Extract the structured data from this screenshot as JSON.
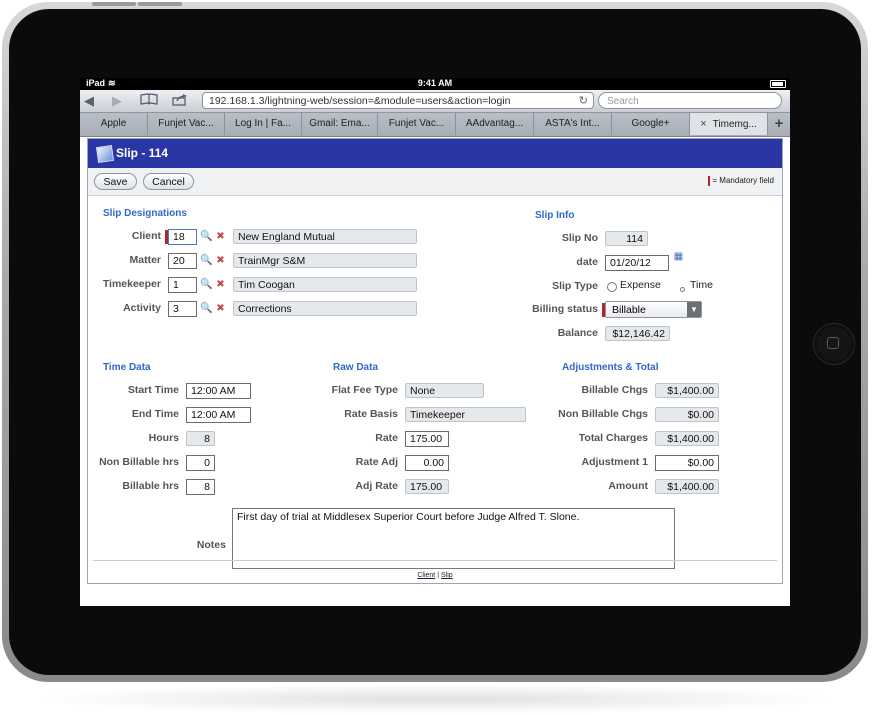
{
  "status_bar": {
    "device": "iPad",
    "time": "9:41 AM"
  },
  "browser": {
    "url": "192.168.1.3/lightning-web/session=&module=users&action=login",
    "search_placeholder": "Search",
    "tabs": [
      {
        "label": "Apple"
      },
      {
        "label": "Funjet Vac..."
      },
      {
        "label": "Log In | Fa..."
      },
      {
        "label": "Gmail: Ema..."
      },
      {
        "label": "Funjet Vac..."
      },
      {
        "label": "AAdvantag..."
      },
      {
        "label": "ASTA's Int..."
      },
      {
        "label": "Google+"
      },
      {
        "label": "Timemg..."
      }
    ],
    "tab_close": "×",
    "tab_add": "+"
  },
  "app": {
    "title": "Slip - 114",
    "save_label": "Save",
    "cancel_label": "Cancel",
    "mandatory_text": "= Mandatory field",
    "slip_designations": {
      "heading": "Slip Designations",
      "client": {
        "label": "Client",
        "id": "18",
        "name": "New England Mutual"
      },
      "matter": {
        "label": "Matter",
        "id": "20",
        "name": "TrainMgr S&M"
      },
      "timekeeper": {
        "label": "Timekeeper",
        "id": "1",
        "name": "Tim Coogan"
      },
      "activity": {
        "label": "Activity",
        "id": "3",
        "name": "Corrections"
      }
    },
    "slip_info": {
      "heading": "Slip Info",
      "slip_no": {
        "label": "Slip No",
        "value": "114"
      },
      "date": {
        "label": "date",
        "value": "01/20/12"
      },
      "slip_type": {
        "label": "Slip Type",
        "option_expense": "Expense",
        "option_time": "Time"
      },
      "billing_status": {
        "label": "Billing status",
        "value": "Billable"
      },
      "balance": {
        "label": "Balance",
        "value": "$12,146.42"
      }
    },
    "time_data": {
      "heading": "Time Data",
      "start_time": {
        "label": "Start Time",
        "value": "12:00 AM"
      },
      "end_time": {
        "label": "End Time",
        "value": "12:00 AM"
      },
      "hours": {
        "label": "Hours",
        "value": "8"
      },
      "non_billable_hrs": {
        "label": "Non Billable hrs",
        "value": "0"
      },
      "billable_hrs": {
        "label": "Billable hrs",
        "value": "8"
      }
    },
    "raw_data": {
      "heading": "Raw Data",
      "flat_fee_type": {
        "label": "Flat Fee Type",
        "value": "None"
      },
      "rate_basis": {
        "label": "Rate Basis",
        "value": "Timekeeper"
      },
      "rate": {
        "label": "Rate",
        "value": "175.00"
      },
      "rate_adj": {
        "label": "Rate Adj",
        "value": "0.00"
      },
      "adj_rate": {
        "label": "Adj Rate",
        "value": "175.00"
      }
    },
    "adjustments": {
      "heading": "Adjustments & Total",
      "billable_chgs": {
        "label": "Billable Chgs",
        "value": "$1,400.00"
      },
      "non_billable_chgs": {
        "label": "Non Billable Chgs",
        "value": "$0.00"
      },
      "total_charges": {
        "label": "Total Charges",
        "value": "$1,400.00"
      },
      "adjustment_1": {
        "label": "Adjustment 1",
        "value": "$0.00"
      },
      "amount": {
        "label": "Amount",
        "value": "$1,400.00"
      }
    },
    "notes": {
      "label": "Notes",
      "value": "First day of trial at Middlesex Superior Court before Judge Alfred T. Slone."
    },
    "footer": {
      "client_link": "Client",
      "separator": "|",
      "slip_link": "Slip"
    }
  }
}
